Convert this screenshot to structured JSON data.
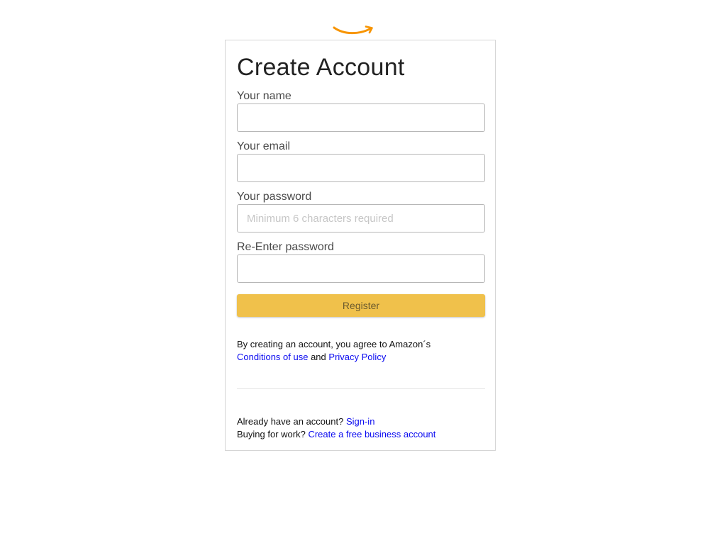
{
  "brand": {
    "logo_icon": "amazon-smile-arrow-icon",
    "accent_color": "#f0c14b",
    "logo_color": "#f79400",
    "link_color": "#0a0af0"
  },
  "form": {
    "title": "Create Account",
    "fields": [
      {
        "label": "Your name",
        "value": "",
        "placeholder": ""
      },
      {
        "label": "Your email",
        "value": "",
        "placeholder": ""
      },
      {
        "label": "Your password",
        "value": "",
        "placeholder": "Minimum 6 characters required"
      },
      {
        "label": "Re-Enter password",
        "value": "",
        "placeholder": ""
      }
    ],
    "register_label": "Register"
  },
  "legal": {
    "text_before": "By creating an account, you agree to Amazon´s",
    "conditions_link": "Conditions of use",
    "and_text": "and",
    "privacy_link": "Privacy Policy"
  },
  "footer": {
    "signin_prompt": "Already have an account?",
    "signin_link": "Sign-in",
    "business_prompt": "Buying for work?",
    "business_link": "Create a free business account"
  }
}
